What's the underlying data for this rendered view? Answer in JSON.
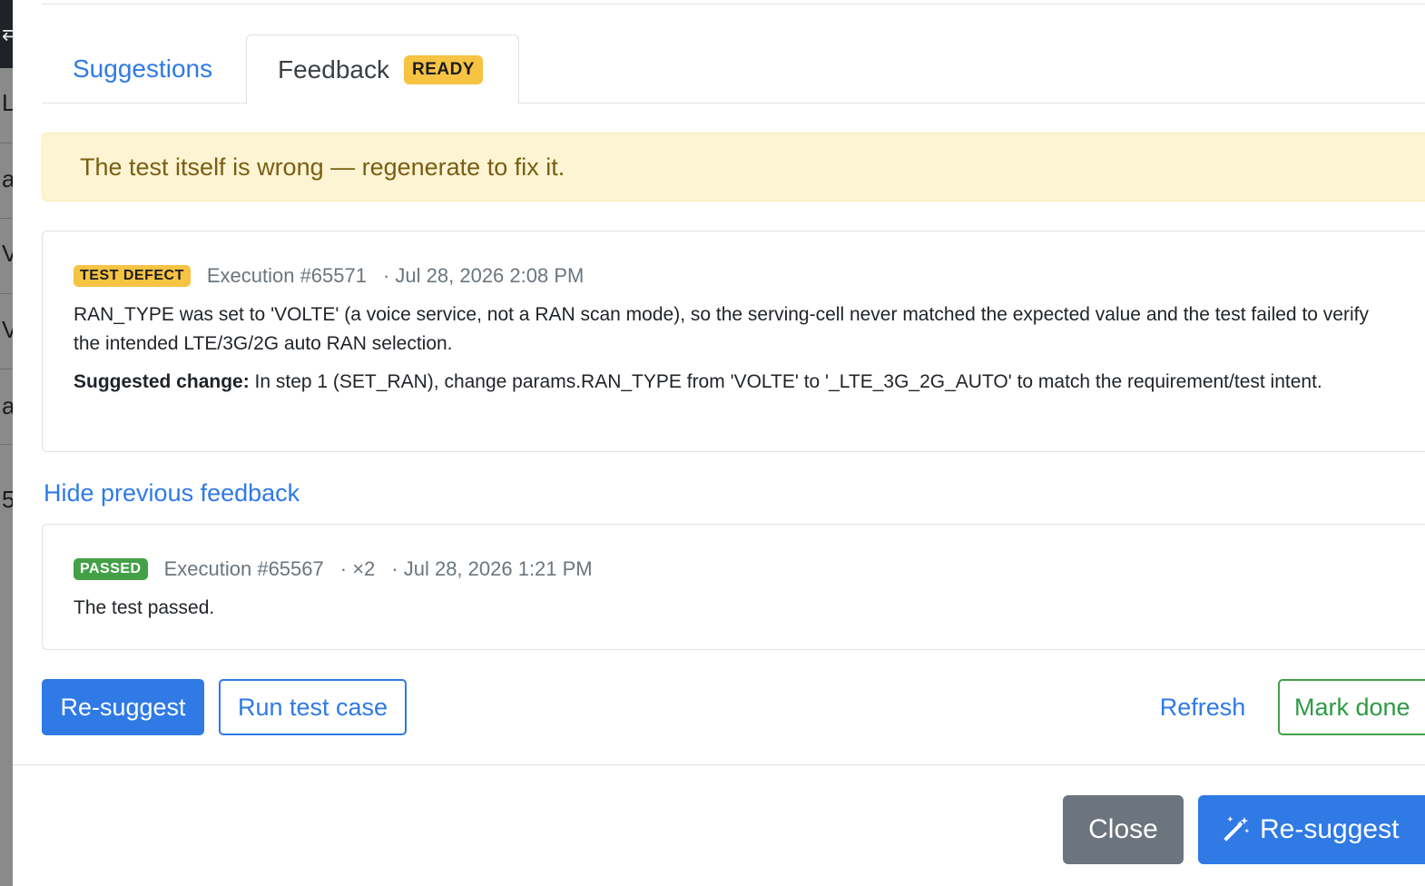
{
  "background": {
    "glyphs": [
      "L",
      "a",
      "V",
      "V",
      "a",
      "5"
    ]
  },
  "tabs": {
    "suggestions_label": "Suggestions",
    "feedback_label": "Feedback",
    "feedback_badge": "READY"
  },
  "alert": {
    "text": "The test itself is wrong — regenerate to fix it."
  },
  "feedback_current": {
    "status": "TEST DEFECT",
    "execution": "Execution #65571",
    "timestamp": "· Jul 28, 2026 2:08 PM",
    "description": "RAN_TYPE was set to 'VOLTE' (a voice service, not a RAN scan mode), so the serving-cell never matched the expected value and the test failed to verify the intended LTE/3G/2G auto RAN selection.",
    "suggested_label": "Suggested change:",
    "suggested_text": " In step 1 (SET_RAN), change params.RAN_TYPE from 'VOLTE' to '_LTE_3G_2G_AUTO' to match the requirement/test intent."
  },
  "toggle_previous": "Hide previous feedback",
  "feedback_previous": {
    "status": "PASSED",
    "execution": "Execution #65567",
    "count": "· ×2",
    "timestamp": "· Jul 28, 2026 1:21 PM",
    "description": "The test passed."
  },
  "actions": {
    "resuggest": "Re-suggest",
    "run_test_case": "Run test case",
    "refresh": "Refresh",
    "mark_done": "Mark done"
  },
  "footer": {
    "close": "Close",
    "resuggest": "Re-suggest"
  },
  "colors": {
    "primary": "#2f7ae5",
    "warning": "#f6c343",
    "success": "#43a047",
    "secondary": "#6c757d",
    "alert_bg": "#fdf4d3"
  }
}
